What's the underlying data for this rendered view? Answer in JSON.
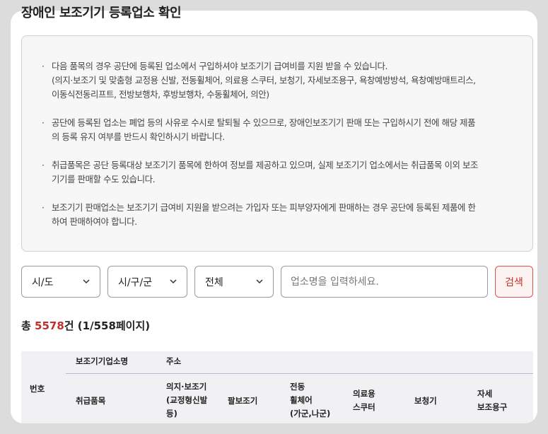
{
  "page": {
    "title": "장애인 보조기기 등록업소 확인"
  },
  "notice": {
    "items": [
      "다음 품목의 경우 공단에 등록된 업소에서 구입하셔야 보조기기 급여비를 지원 받을 수 있습니다.",
      "(의지·보조기 및 맞춤형 교정용 신발, 전동휠체어, 의료용 스쿠터, 보청기, 자세보조용구, 욕창예방방석, 욕창예방매트리스,",
      "이동식전동리프트, 전방보행차, 후방보행차, 수동휠체어, 의안)",
      "공단에 등록된 업소는 폐업 등의 사유로 수시로 탈퇴될 수 있으므로, 장애인보조기기 판매 또는 구입하시기 전에 해당 제품",
      "의 등록 유지 여부를 반드시 확인하시기 바랍니다.",
      "취급품목은 공단 등록대상 보조기기 품목에 한하여 정보를 제공하고 있으며, 실제 보조기기 업소에서는 취급품목 이외 보조",
      "기기를 판매할 수도 있습니다.",
      "보조기기 판매업소는 보조기기 급여비 지원을 받으려는 가입자 또는 피부양자에게 판매하는 경우 공단에 등록된 제품에 한",
      "하여 판매하여야 합니다."
    ],
    "bullet": "·"
  },
  "filters": {
    "sido": "시/도",
    "sigungu": "시/구/군",
    "category": "전체",
    "search_placeholder": "업소명을 입력하세요.",
    "search_button": "검색"
  },
  "summary": {
    "prefix": "총 ",
    "count": "5578",
    "suffix": "건 (1/558페이지)"
  },
  "table": {
    "col_no": "번호",
    "col_name": "보조기기업소명",
    "col_address": "주소",
    "col_items": "취급품목",
    "sub_orthosis": [
      "의지·보조기",
      "(교정형신발",
      "등)"
    ],
    "sub_arm": "팔보조기",
    "sub_wheelchair": [
      "전동",
      "휠체어",
      "(가군,나군)"
    ],
    "sub_scooter": [
      "의료용",
      "스쿠터"
    ],
    "sub_hearing": "보청기",
    "sub_posture": [
      "자세",
      "보조용구"
    ]
  },
  "colors": {
    "accent": "#c0302b",
    "background": "#dcdcdc"
  }
}
